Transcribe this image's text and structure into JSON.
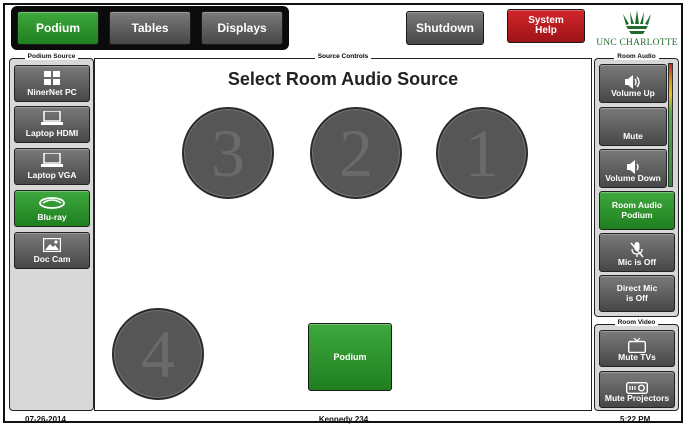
{
  "nav": {
    "podium": "Podium",
    "tables": "Tables",
    "displays": "Displays",
    "shutdown": "Shutdown",
    "system_help": "System\nHelp"
  },
  "logo": {
    "text": "UNC CHARLOTTE"
  },
  "podium_source": {
    "title": "Podium Source",
    "items": [
      {
        "label": "NinerNet PC",
        "icon": "windows-icon"
      },
      {
        "label": "Laptop HDMI",
        "icon": "laptop-icon"
      },
      {
        "label": "Laptop VGA",
        "icon": "laptop-icon"
      },
      {
        "label": "Blu-ray",
        "icon": "bluray-icon",
        "active": true
      },
      {
        "label": "Doc Cam",
        "icon": "image-icon"
      }
    ]
  },
  "source_controls": {
    "title": "Source Controls",
    "heading": "Select Room Audio Source",
    "sources": [
      "3",
      "2",
      "1",
      "4"
    ],
    "podium_button": "Podium"
  },
  "room_audio": {
    "title": "Room Audio",
    "volume_up": "Volume Up",
    "mute": "Mute",
    "volume_down": "Volume Down",
    "room_audio_podium": "Room Audio\nPodium",
    "mic_off": "Mic is Off",
    "direct_mic": "Direct Mic\nis Off"
  },
  "room_video": {
    "title": "Room Video",
    "mute_tvs": "Mute TVs",
    "mute_projectors": "Mute Projectors"
  },
  "footer": {
    "date": "07-26-2014",
    "room": "Kennedy 234",
    "time": "5:22 PM"
  },
  "colors": {
    "active_green": "#2a9a2a",
    "alert_red": "#c41e23",
    "button_gray": "#5e5e5e"
  }
}
